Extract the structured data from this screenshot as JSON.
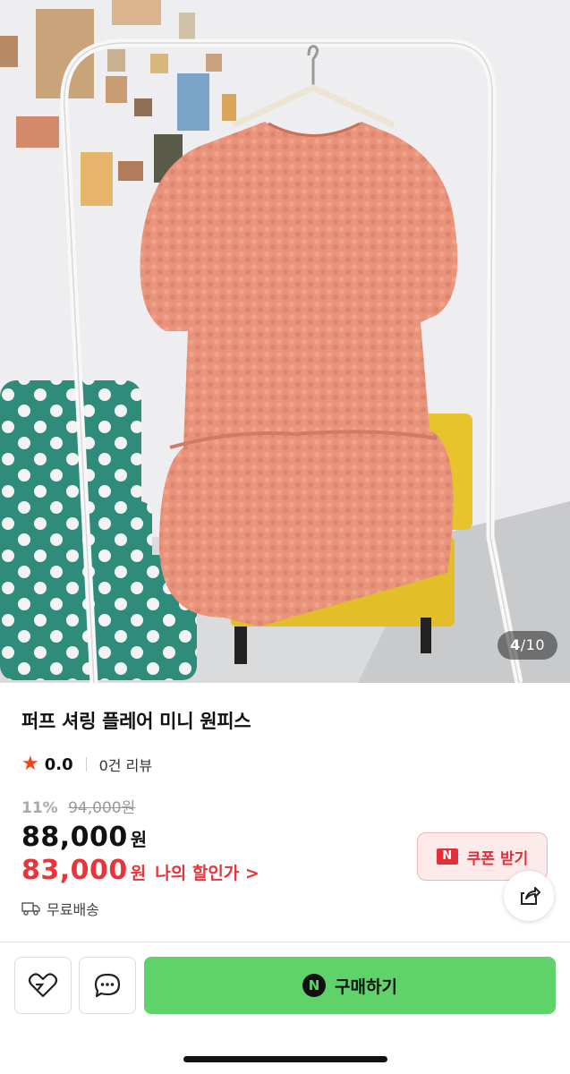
{
  "gallery": {
    "current": "4",
    "separator": "/",
    "total": "10"
  },
  "product": {
    "title": "퍼프 셔링 플레어 미니 원피스",
    "rating": "0.0",
    "review_count": "0건 리뷰",
    "discount_percent": "11%",
    "original_price": "94,000원",
    "price": "88,000",
    "price_unit": "원",
    "my_price": "83,000",
    "my_price_unit": "원",
    "my_price_link": "나의 할인가 >",
    "shipping": "무료배송"
  },
  "coupon": {
    "badge": "N",
    "label": "쿠폰 받기"
  },
  "bottom_bar": {
    "buy_badge": "N",
    "buy_label": "구매하기"
  },
  "colors": {
    "accent_red": "#e8343b",
    "buy_green": "#5fd36a",
    "coupon_bg": "#fdeaea"
  },
  "icons": [
    "star-icon",
    "truck-icon",
    "share-icon",
    "heart-icon",
    "chat-icon"
  ]
}
